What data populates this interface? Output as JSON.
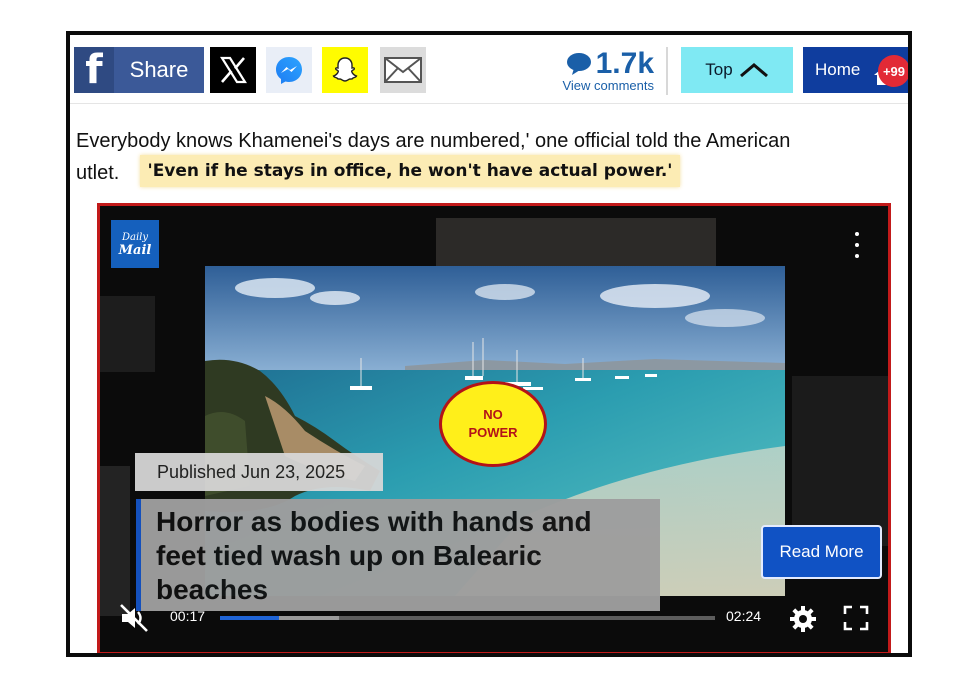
{
  "toolbar": {
    "facebook_glyph": "f",
    "share_label": "Share",
    "comments_count": "1.7k",
    "comments_link": "View comments",
    "top_label": "Top",
    "home_label": "Home",
    "home_badge": "+99",
    "icons": [
      "facebook-icon",
      "x-icon",
      "messenger-icon",
      "snapchat-icon",
      "email-icon",
      "comment-bubble-icon",
      "chevron-up-icon",
      "home-icon"
    ]
  },
  "article": {
    "line1": "Everybody knows Khamenei's days are numbered,' one official told the American",
    "line2": "utlet.",
    "highlight_quote": "'Even if he stays in office, he won't have actual power.'"
  },
  "video": {
    "logo_line1": "Daily",
    "logo_line2": "Mail",
    "stamp_line1": "NO",
    "stamp_line2": "POWER",
    "published": "Published Jun 23, 2025",
    "headline": "Horror as bodies with hands and feet tied wash up on Balearic beaches",
    "read_more": "Read More",
    "time_current": "00:17",
    "time_duration": "02:24",
    "progress_fraction": 0.12,
    "buffered_fraction": 0.24,
    "icons": [
      "muted-speaker-icon",
      "settings-gear-icon",
      "fullscreen-icon",
      "more-options-icon"
    ]
  },
  "colors": {
    "facebook": "#3b5998",
    "snapchat": "#fffc00",
    "top_button": "#7fe9f3",
    "home_button": "#0f3d9e",
    "badge": "#e22a36",
    "highlight": "#fcecb4",
    "video_border": "#c21a1a",
    "read_more": "#1052c4",
    "progress": "#1f64d6"
  }
}
